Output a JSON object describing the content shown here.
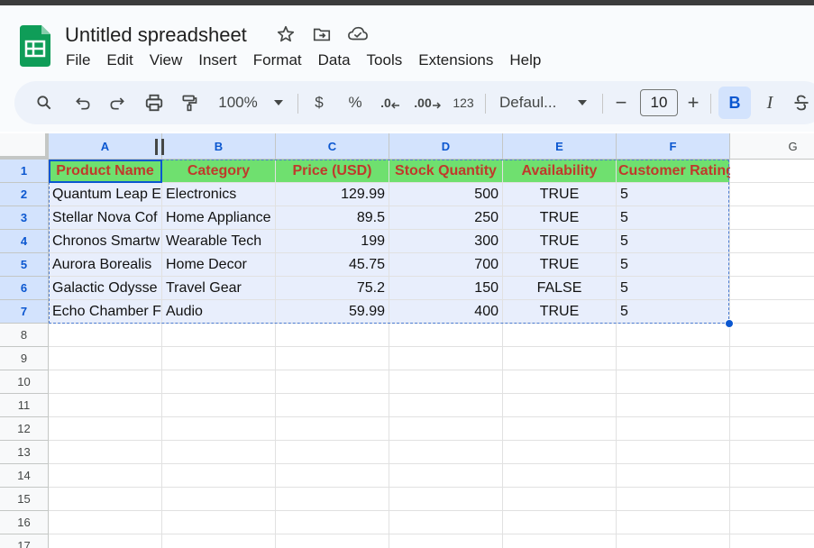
{
  "app": {
    "title": "Untitled spreadsheet",
    "icons": [
      "star-icon",
      "move-to-folder-icon",
      "cloud-status-icon"
    ],
    "brand_color": "#0f9d58"
  },
  "menu": [
    "File",
    "Edit",
    "View",
    "Insert",
    "Format",
    "Data",
    "Tools",
    "Extensions",
    "Help"
  ],
  "toolbar": {
    "zoom": "100%",
    "currency": "$",
    "percent": "%",
    "decrease_decimal": ".0",
    "increase_decimal": ".00",
    "number_format": "123",
    "font": "Defaul...",
    "font_size": "10",
    "minus": "−",
    "plus": "+",
    "bold": "B",
    "italic": "I"
  },
  "columns": [
    "A",
    "B",
    "C",
    "D",
    "E",
    "F",
    "G"
  ],
  "rows": [
    "1",
    "2",
    "3",
    "4",
    "5",
    "6",
    "7",
    "8",
    "9",
    "10",
    "11",
    "12",
    "13",
    "14",
    "15",
    "16",
    "17"
  ],
  "header_row": [
    "Product Name",
    "Category",
    "Price (USD)",
    "Stock Quantity",
    "Availability",
    "Customer Rating"
  ],
  "data_rows": [
    [
      "Quantum Leap E",
      "Electronics",
      "129.99",
      "500",
      "TRUE",
      "5"
    ],
    [
      "Stellar Nova Cof",
      "Home Appliance",
      "89.5",
      "250",
      "TRUE",
      "5"
    ],
    [
      "Chronos Smartw",
      "Wearable Tech",
      "199",
      "300",
      "TRUE",
      "5"
    ],
    [
      "Aurora Borealis",
      "Home Decor",
      "45.75",
      "700",
      "TRUE",
      "5"
    ],
    [
      "Galactic Odysse",
      "Travel Gear",
      "75.2",
      "150",
      "FALSE",
      "5"
    ],
    [
      "Echo Chamber F",
      "Audio",
      "59.99",
      "400",
      "TRUE",
      "5"
    ]
  ],
  "colors": {
    "header_fill": "#6fe06f",
    "header_text": "#c0392b",
    "selection_fill": "#e8eefc",
    "selection_border": "#4a7bd1"
  }
}
